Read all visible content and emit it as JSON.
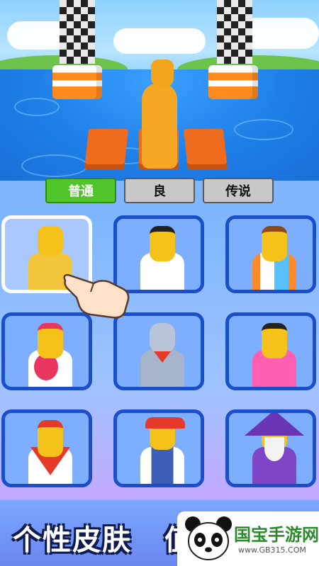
{
  "tabs": [
    {
      "label": "普通",
      "active": true
    },
    {
      "label": "良",
      "active": false
    },
    {
      "label": "传说",
      "active": false
    }
  ],
  "skins": [
    {
      "id": "plain-yellow",
      "selected": true,
      "color": "#f2c53a"
    },
    {
      "id": "karate-white",
      "selected": false,
      "color": "#ffffff"
    },
    {
      "id": "blue-shirt-orange-sleeves",
      "selected": false,
      "color": "#57c0ff"
    },
    {
      "id": "tennis-player",
      "selected": false,
      "color": "#e8365f"
    },
    {
      "id": "knight",
      "selected": false,
      "color": "#a6b4cc"
    },
    {
      "id": "pink-dress",
      "selected": false,
      "color": "#ff5fb0"
    },
    {
      "id": "bandana-red",
      "selected": false,
      "color": "#e53a2a"
    },
    {
      "id": "cap-overalls",
      "selected": false,
      "color": "#3d5fb8"
    },
    {
      "id": "wizard",
      "selected": false,
      "color": "#7e45c7"
    }
  ],
  "banner": {
    "slogan": "个性皮肤",
    "slogan_extra": "值"
  },
  "watermark": {
    "site_name": "国宝手游网",
    "url": "www.GB315.COM"
  },
  "colors": {
    "tab_active": "#4fc52a",
    "cell_border": "#1a4fc9",
    "selected_border": "#ffffff"
  }
}
